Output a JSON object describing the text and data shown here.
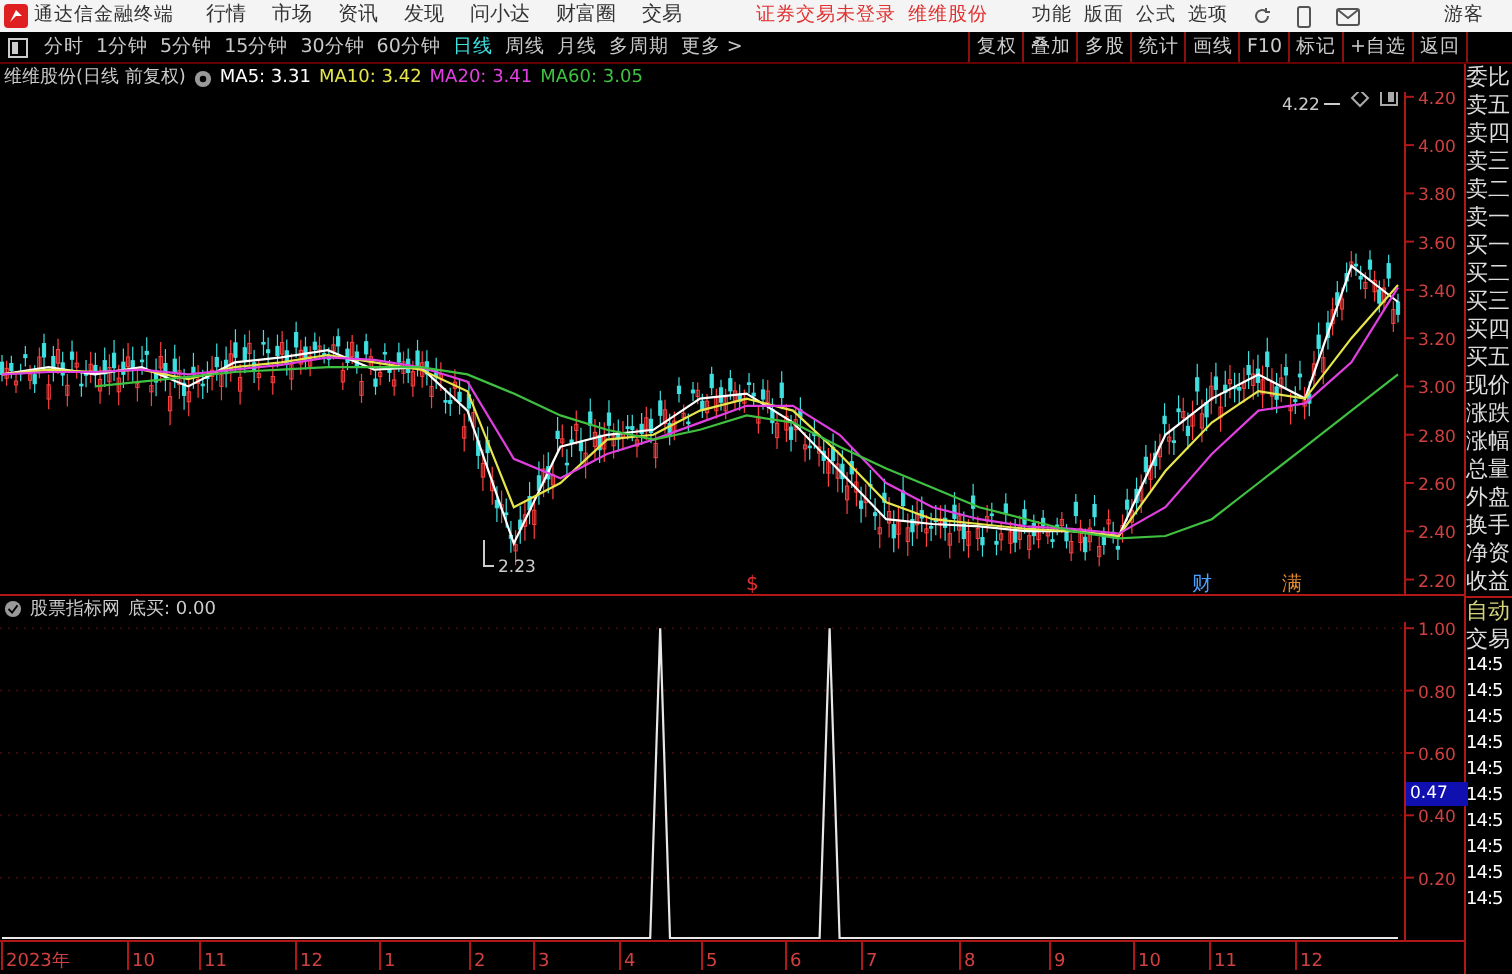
{
  "app": {
    "title": "通达信金融终端",
    "menu": [
      "行情",
      "市场",
      "资讯",
      "发现",
      "问小达",
      "财富圈",
      "交易"
    ],
    "notice": "证券交易未登录",
    "stock_link": "维维股份",
    "tools": [
      "功能",
      "版面",
      "公式",
      "选项"
    ],
    "user": "游客"
  },
  "periods": [
    {
      "label": "分时",
      "selected": false
    },
    {
      "label": "1分钟",
      "selected": false
    },
    {
      "label": "5分钟",
      "selected": false
    },
    {
      "label": "15分钟",
      "selected": false
    },
    {
      "label": "30分钟",
      "selected": false
    },
    {
      "label": "60分钟",
      "selected": false
    },
    {
      "label": "日线",
      "selected": true
    },
    {
      "label": "周线",
      "selected": false
    },
    {
      "label": "月线",
      "selected": false
    },
    {
      "label": "多周期",
      "selected": false
    },
    {
      "label": "更多 >",
      "selected": false
    }
  ],
  "actions": [
    "复权",
    "叠加",
    "多股",
    "统计",
    "画线",
    "F10",
    "标记",
    "+自选",
    "返回"
  ],
  "price_chart": {
    "title": "维维股份(日线 前复权)",
    "readings": [
      "3.31",
      "3.42",
      "3.41",
      "3.05"
    ],
    "high_label": "4.22",
    "low_label": "2.23",
    "markers": [
      {
        "text": "$",
        "color": "#e03030"
      },
      {
        "text": "财",
        "color": "#4aa0ff"
      },
      {
        "text": "满",
        "color": "#e08a30"
      }
    ],
    "chart_data": {
      "type": "line",
      "ylim": [
        2.14,
        4.22
      ],
      "series": [
        {
          "name": "MA5:",
          "color": "#ffffff",
          "values": [
            3.05,
            3.08,
            3.05,
            3.08,
            3.0,
            3.1,
            3.12,
            3.15,
            3.07,
            3.08,
            2.9,
            2.35,
            2.75,
            2.8,
            2.82,
            2.95,
            2.97,
            2.85,
            2.65,
            2.45,
            2.43,
            2.42,
            2.4,
            2.4,
            2.38,
            2.8,
            2.95,
            3.05,
            2.95,
            3.5,
            3.35
          ]
        },
        {
          "name": "MA10:",
          "color": "#e6e64c",
          "values": [
            3.05,
            3.07,
            3.06,
            3.07,
            3.03,
            3.08,
            3.1,
            3.13,
            3.1,
            3.07,
            2.98,
            2.5,
            2.6,
            2.78,
            2.8,
            2.9,
            2.95,
            2.9,
            2.72,
            2.52,
            2.45,
            2.43,
            2.41,
            2.4,
            2.38,
            2.65,
            2.85,
            2.98,
            2.95,
            3.2,
            3.42
          ]
        },
        {
          "name": "MA20:",
          "color": "#e040e0",
          "values": [
            3.05,
            3.06,
            3.06,
            3.07,
            3.05,
            3.07,
            3.09,
            3.12,
            3.11,
            3.08,
            3.02,
            2.7,
            2.62,
            2.72,
            2.78,
            2.85,
            2.92,
            2.92,
            2.8,
            2.6,
            2.5,
            2.45,
            2.42,
            2.41,
            2.39,
            2.5,
            2.72,
            2.9,
            2.93,
            3.1,
            3.41
          ]
        },
        {
          "name": "MA60:",
          "color": "#40c040",
          "values": [
            null,
            null,
            3.0,
            3.02,
            3.04,
            3.06,
            3.07,
            3.08,
            3.08,
            3.08,
            3.05,
            2.97,
            2.88,
            2.82,
            2.78,
            2.82,
            2.88,
            2.85,
            2.75,
            2.66,
            2.58,
            2.5,
            2.45,
            2.4,
            2.37,
            2.38,
            2.45,
            2.6,
            2.75,
            2.9,
            3.05
          ]
        }
      ],
      "yticks": [
        {
          "value": 4.2,
          "label": "4.20"
        },
        {
          "value": 4.0,
          "label": "4.00"
        },
        {
          "value": 3.8,
          "label": "3.80"
        },
        {
          "value": 3.6,
          "label": "3.60"
        },
        {
          "value": 3.4,
          "label": "3.40"
        },
        {
          "value": 3.2,
          "label": "3.20"
        },
        {
          "value": 3.0,
          "label": "3.00"
        },
        {
          "value": 2.8,
          "label": "2.80"
        },
        {
          "value": 2.6,
          "label": "2.60"
        },
        {
          "value": 2.4,
          "label": "2.40"
        },
        {
          "value": 2.2,
          "label": "2.20"
        }
      ]
    }
  },
  "indicator_chart": {
    "title": "股票指标网",
    "reading": "0.00",
    "cursor_value": "0.47",
    "chart_data": {
      "type": "line",
      "categories": [
        null,
        null,
        null,
        null,
        null,
        null,
        null,
        null,
        null,
        null,
        null,
        null,
        null,
        null,
        null,
        null,
        null,
        null,
        null,
        null,
        null,
        null,
        null,
        null,
        null,
        null,
        null,
        null,
        null,
        null,
        null,
        null,
        null,
        null,
        null,
        null,
        null,
        null,
        null,
        null,
        null,
        null,
        null,
        null,
        null,
        null,
        null,
        null,
        null,
        null,
        null,
        null,
        null,
        null,
        null,
        null,
        null,
        null,
        null,
        null,
        null,
        null,
        null,
        null,
        null,
        null,
        null,
        null,
        null,
        null,
        null,
        null,
        null,
        null,
        null,
        null,
        null,
        null,
        null,
        null,
        null,
        null,
        null,
        null,
        null,
        null,
        null,
        null,
        null,
        null,
        null,
        null,
        null,
        null,
        null,
        null,
        null,
        null,
        null,
        null,
        null,
        null,
        null,
        null,
        null,
        null,
        null,
        null,
        null,
        null,
        null,
        null,
        null,
        null,
        null,
        null,
        null,
        null,
        null,
        null,
        null,
        null,
        null,
        null,
        null,
        null,
        null,
        null,
        null,
        null,
        null,
        null,
        null,
        null,
        null,
        null,
        null,
        null,
        null,
        null,
        null
      ],
      "series": [
        {
          "name": "底买:",
          "color": "#e8e8e8",
          "values": [
            0,
            0,
            0,
            0,
            0,
            0,
            0,
            0,
            0,
            0,
            0,
            0,
            0,
            0,
            0,
            0,
            0,
            0,
            0,
            0,
            0,
            0,
            0,
            0,
            0,
            0,
            0,
            0,
            0,
            0,
            0,
            0,
            0,
            0,
            0,
            0,
            0,
            0,
            0,
            0,
            0,
            0,
            0,
            0,
            0,
            0,
            0,
            0,
            0,
            0,
            0,
            0,
            0,
            0,
            0,
            0,
            0,
            0,
            0,
            0,
            0,
            0,
            0,
            0,
            0,
            0,
            1,
            0,
            0,
            0,
            0,
            0,
            0,
            0,
            0,
            0,
            0,
            0,
            0,
            0,
            0,
            0,
            0,
            1,
            0,
            0,
            0,
            0,
            0,
            0,
            0,
            0,
            0,
            0,
            0,
            0,
            0,
            0,
            0,
            0,
            0,
            0,
            0,
            0,
            0,
            0,
            0,
            0,
            0,
            0,
            0,
            0,
            0,
            0,
            0,
            0,
            0,
            0,
            0,
            0,
            0,
            0,
            0,
            0,
            0,
            0,
            0,
            0,
            0,
            0,
            0,
            0,
            0,
            0,
            0,
            0,
            0,
            0,
            0,
            0,
            0
          ]
        }
      ],
      "ylim": [
        0,
        1.02
      ],
      "grid": true,
      "yticks": [
        {
          "value": 1,
          "label": "1.00"
        },
        {
          "value": 0.8,
          "label": "0.80"
        },
        {
          "value": 0.6,
          "label": "0.60"
        },
        {
          "value": 0.4,
          "label": "0.40"
        },
        {
          "value": 0.2,
          "label": "0.20"
        }
      ]
    }
  },
  "x_axis": [
    "2023年",
    "10",
    "11",
    "12",
    "1",
    "2",
    "3",
    "4",
    "5",
    "6",
    "7",
    "8",
    "9",
    "10",
    "11",
    "12"
  ],
  "quote_panel": [
    {
      "label": "委比",
      "kind": "field"
    },
    {
      "label": "卖五",
      "kind": "field"
    },
    {
      "label": "卖四",
      "kind": "field"
    },
    {
      "label": "卖三",
      "kind": "field"
    },
    {
      "label": "卖二",
      "kind": "field"
    },
    {
      "label": "卖一",
      "kind": "field"
    },
    {
      "label": "买一",
      "kind": "field"
    },
    {
      "label": "买二",
      "kind": "field"
    },
    {
      "label": "买三",
      "kind": "field"
    },
    {
      "label": "买四",
      "kind": "field"
    },
    {
      "label": "买五",
      "kind": "field"
    },
    {
      "label": "现价",
      "kind": "field"
    },
    {
      "label": "涨跌",
      "kind": "field"
    },
    {
      "label": "涨幅",
      "kind": "field"
    },
    {
      "label": "总量",
      "kind": "field"
    },
    {
      "label": "外盘",
      "kind": "field"
    },
    {
      "label": "换手",
      "kind": "field"
    },
    {
      "label": "净资",
      "kind": "field"
    },
    {
      "label": "收益",
      "kind": "field"
    },
    {
      "label": "自动",
      "kind": "header"
    },
    {
      "label": "交易",
      "kind": "field"
    },
    {
      "label": "14:5",
      "kind": "time"
    },
    {
      "label": "14:5",
      "kind": "time"
    },
    {
      "label": "14:5",
      "kind": "time"
    },
    {
      "label": "14:5",
      "kind": "time"
    },
    {
      "label": "14:5",
      "kind": "time"
    },
    {
      "label": "14:5",
      "kind": "time"
    },
    {
      "label": "14:5",
      "kind": "time"
    },
    {
      "label": "14:5",
      "kind": "time"
    },
    {
      "label": "14:5",
      "kind": "time"
    },
    {
      "label": "14:5",
      "kind": "time"
    }
  ]
}
